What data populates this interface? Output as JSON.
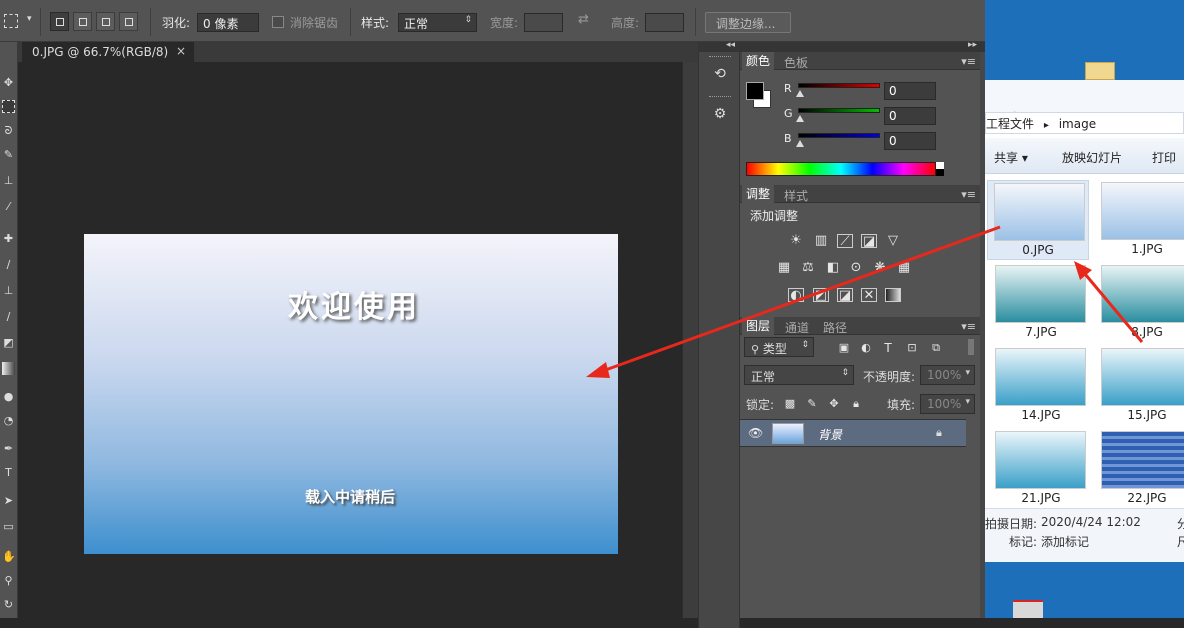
{
  "options_bar": {
    "feather_label": "羽化:",
    "feather_value": "0 像素",
    "antialias_label": "消除锯齿",
    "style_label": "样式:",
    "style_value": "正常",
    "width_label": "宽度:",
    "height_label": "高度:",
    "refine_button": "调整边缘..."
  },
  "document": {
    "tab_title": "0.JPG @ 66.7%(RGB/8)",
    "close_symbol": "×",
    "image_title": "欢迎使用",
    "image_subtitle": "载入中请稍后"
  },
  "color_panel": {
    "tabs": [
      "颜色",
      "色板"
    ],
    "channels": [
      {
        "label": "R",
        "value": "0",
        "color": "#e00000"
      },
      {
        "label": "G",
        "value": "0",
        "color": "#00c000"
      },
      {
        "label": "B",
        "value": "0",
        "color": "#0000e0"
      }
    ],
    "foreground": "#000000",
    "background": "#ffffff"
  },
  "adjust_panel": {
    "tabs": [
      "调整",
      "样式"
    ],
    "heading": "添加调整",
    "icon_row1": [
      "brightness-icon",
      "levels-icon",
      "curves-icon",
      "exposure-icon",
      "vibrance-icon"
    ],
    "icon_row2": [
      "hue-sat-icon",
      "color-balance-icon",
      "bw-icon",
      "photo-filter-icon",
      "channel-mixer-icon",
      "color-lookup-icon"
    ],
    "icon_row3": [
      "invert-icon",
      "posterize-icon",
      "threshold-icon",
      "selective-color-icon",
      "gradient-map-icon"
    ]
  },
  "layers_panel": {
    "tabs": [
      "图层",
      "通道",
      "路径"
    ],
    "filter_label": "类型",
    "blend_mode": "正常",
    "opacity_label": "不透明度:",
    "opacity_value": "100%",
    "lock_label": "锁定:",
    "fill_label": "填充:",
    "fill_value": "100%",
    "layer_name": "背景"
  },
  "explorer": {
    "breadcrumb_part1": "工程文件",
    "breadcrumb_sep": "▸",
    "breadcrumb_part2": "image",
    "share_button": "共享 ▾",
    "slideshow_button": "放映幻灯片",
    "print_button": "打印",
    "thumbnails": [
      "0.JPG",
      "1.JPG",
      "7.JPG",
      "8.JPG",
      "14.JPG",
      "15.JPG",
      "21.JPG",
      "22.JPG"
    ],
    "date_label": "拍摄日期:",
    "date_value": "2020/4/24 12:02",
    "tag_label": "标记:",
    "tag_value": "添加标记",
    "right_cut_1": "分",
    "right_cut_2": "尺"
  },
  "colors": {
    "annotation_arrow": "#e8281c",
    "ps_bg": "#282828",
    "panel_bg": "#535353"
  }
}
